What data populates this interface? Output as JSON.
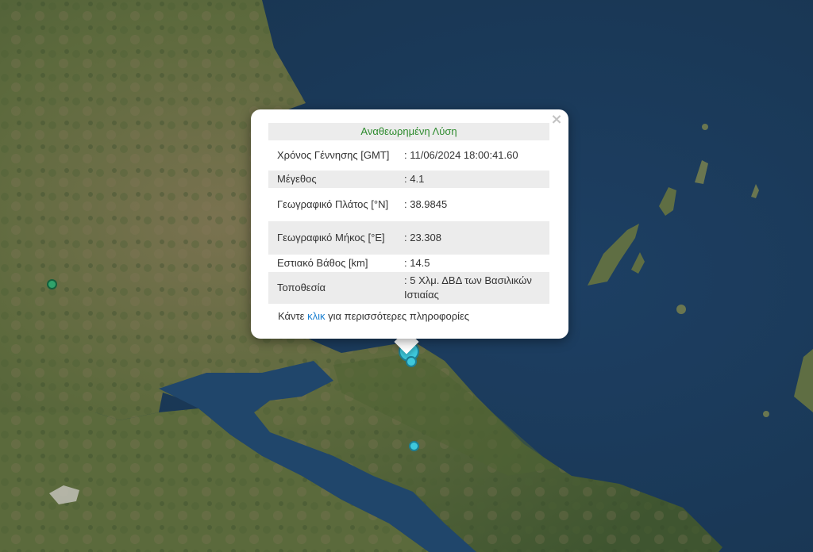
{
  "popup": {
    "title": "Αναθεωρημένη Λύση",
    "rows": [
      {
        "label": "Χρόνος Γέννησης [GMT]",
        "value": ": 11/06/2024 18:00:41.60"
      },
      {
        "label": "Μέγεθος",
        "value": ": 4.1"
      },
      {
        "label": "Γεωγραφικό Πλάτος [°N]",
        "value": ": 38.9845"
      },
      {
        "label": "Γεωγραφικό Μήκος [°E]",
        "value": ": 23.308"
      },
      {
        "label": "Εστιακό Βάθος [km]",
        "value": ": 14.5"
      },
      {
        "label": "Τοποθεσία",
        "value": ": 5 Χλμ. ΔΒΔ των Βασιλικών Ιστιαίας"
      }
    ],
    "more_prefix": "Κάντε ",
    "more_link": "κλικ",
    "more_suffix": " για περισσότερες πληροφορίες",
    "close_symbol": "×"
  },
  "colors": {
    "sea": "#1e3b5c",
    "land": "#5a6b3c",
    "selected_marker": "#3ec8dc",
    "event_marker": "#3ec8dc",
    "old_event_marker": "#2fa36b",
    "popup_title": "#2e8b2e",
    "link": "#1a7fd0"
  },
  "icons": {
    "close": "close-icon",
    "marker": "earthquake-marker-icon"
  }
}
